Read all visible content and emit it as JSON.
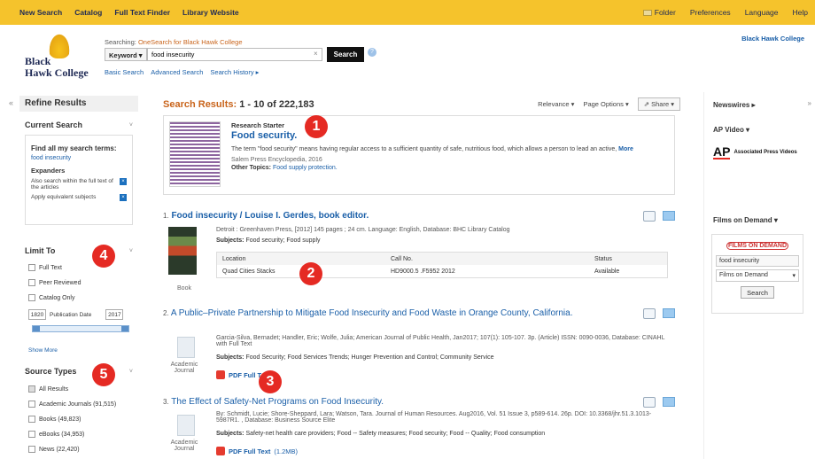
{
  "topbar": {
    "left": [
      "New Search",
      "Catalog",
      "Full Text Finder",
      "Library Website"
    ],
    "right": [
      "Folder",
      "Preferences",
      "Language",
      "Help"
    ]
  },
  "header": {
    "logo_line1": "Black",
    "logo_line2": "Hawk College",
    "searching_prefix": "Searching: ",
    "searching_target": "OneSearch for Black Hawk College",
    "keyword_label": "Keyword ▾",
    "query": "food insecurity",
    "search_button": "Search",
    "links": [
      "Basic Search",
      "Advanced Search",
      "Search History ▸"
    ],
    "institution": "Black Hawk College"
  },
  "left": {
    "refine_title": "Refine Results",
    "current_search": "Current Search",
    "find_all": "Find all my search terms:",
    "term": "food insecurity",
    "expanders": "Expanders",
    "expander1": "Also search within the full text of the articles",
    "expander2": "Apply equivalent subjects",
    "limit_to": "Limit To",
    "limits": [
      "Full Text",
      "Peer Reviewed",
      "Catalog Only"
    ],
    "pub_from": "1820",
    "pub_label": "Publication Date",
    "pub_to": "2017",
    "show_more": "Show More",
    "source_types": "Source Types",
    "sources": [
      "All Results",
      "Academic Journals (91,515)",
      "Books (49,823)",
      "eBooks (34,953)",
      "News (22,420)"
    ]
  },
  "markers": [
    "1",
    "2",
    "3",
    "4",
    "5"
  ],
  "main": {
    "results_label": "Search Results: ",
    "results_range": "1 - 10 of 222,183",
    "relevance": "Relevance ▾",
    "page_options": "Page Options ▾",
    "share": "Share ▾",
    "starter": {
      "label": "Research Starter",
      "title": "Food security.",
      "desc": "The term \"food security\" means having regular access to a sufficient quantity of safe, nutritious food, which allows a person to lead an active,",
      "more": "More",
      "source": "Salem Press Encyclopedia, 2016",
      "topics_label": "Other Topics: ",
      "topics": "Food supply protection."
    },
    "r1": {
      "num": "1.",
      "title": "Food insecurity / Louise I. Gerdes, book editor.",
      "meta": "Detroit : Greenhaven Press, [2012] 145 pages ; 24 cm. Language: English, Database: BHC Library Catalog",
      "subjects_label": "Subjects: ",
      "subjects": "Food security; Food supply",
      "format": "Book",
      "cols": [
        "Location",
        "Call No.",
        "Status"
      ],
      "row": [
        "Quad Cities Stacks",
        "HD9000.5 .F5952 2012",
        "Available"
      ]
    },
    "r2": {
      "num": "2.",
      "title": "A Public–Private Partnership to Mitigate Food Insecurity and Food Waste in Orange County, California.",
      "meta": "Garcia-Silva, Bernadet; Handler, Eric; Wolfe, Julia; American Journal of Public Health, Jan2017; 107(1): 105-107. 3p. (Article) ISSN: 0090-0036, Database: CINAHL with Full Text",
      "subjects_label": "Subjects: ",
      "subjects": "Food Security; Food Services Trends; Hunger Prevention and Control; Community Service",
      "format": "Academic Journal",
      "pdf": "PDF Full Text"
    },
    "r3": {
      "num": "3.",
      "title": "The Effect of Safety-Net Programs on Food Insecurity.",
      "meta": "By: Schmidt, Lucie; Shore-Sheppard, Lara; Watson, Tara. Journal of Human Resources. Aug2016, Vol. 51 Issue 3, p589-614. 26p. DOI: 10.3368/jhr.51.3.1013-5987R1. , Database: Business Source Elite",
      "subjects_label": "Subjects: ",
      "subjects": "Safety-net health care providers; Food -- Safety measures; Food security; Food -- Quality; Food consumption",
      "format": "Academic Journal",
      "pdf": "PDF Full Text",
      "pdf_size": "(1.2MB)"
    }
  },
  "right": {
    "newswires": "Newswires ▸",
    "ap_video": "AP Video ▾",
    "ap": "AP",
    "ap_text": "Associated Press Videos",
    "films": "Films on Demand ▾",
    "fod_logo": "FILMS ON DEMAND",
    "fod_query": "food insecurity",
    "fod_select": "Films on Demand",
    "fod_button": "Search"
  }
}
